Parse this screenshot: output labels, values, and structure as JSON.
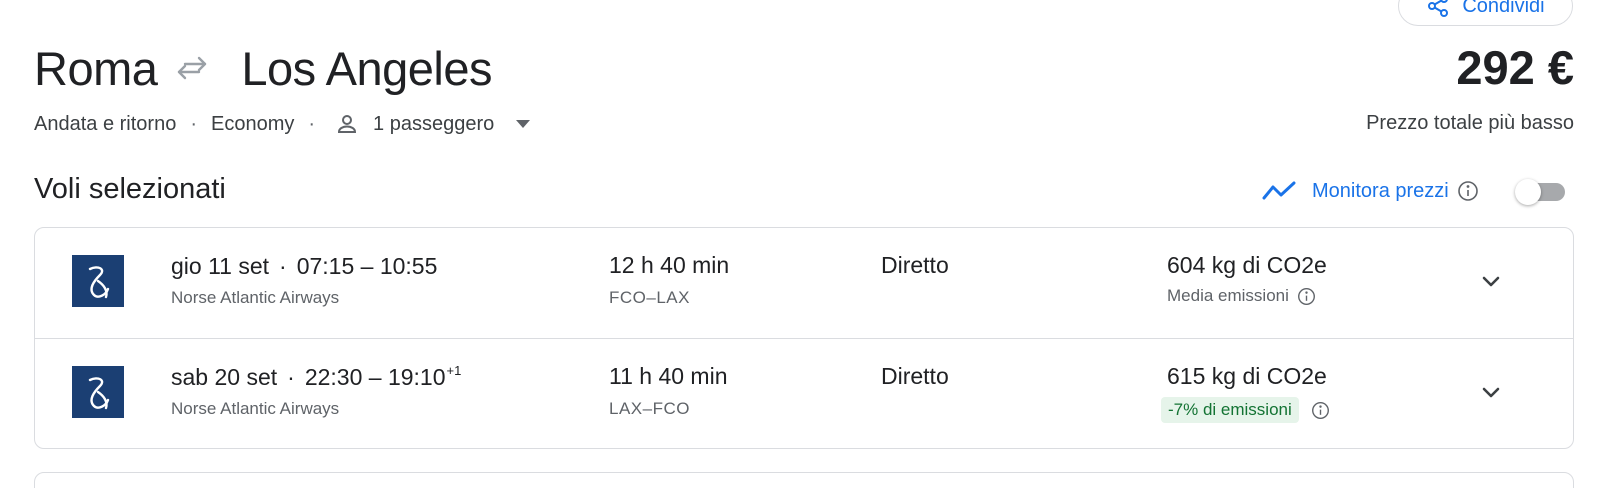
{
  "header": {
    "share_label": "Condividi",
    "origin": "Roma",
    "destination": "Los Angeles",
    "price": "292 €",
    "price_label": "Prezzo totale più basso",
    "trip_type": "Andata e ritorno",
    "cabin_class": "Economy",
    "passengers": "1 passeggero"
  },
  "section": {
    "title": "Voli selezionati",
    "track_label": "Monitora prezzi",
    "track_enabled": false
  },
  "flights": [
    {
      "date": "gio 11 set",
      "time_range": "07:15 – 10:55",
      "day_offset": "",
      "airline": "Norse Atlantic Airways",
      "duration": "12 h 40 min",
      "airports": "FCO–LAX",
      "stops": "Diretto",
      "emissions": "604 kg di CO2e",
      "emissions_note": "Media emissioni"
    },
    {
      "date": "sab 20 set",
      "time_range": "22:30 – 19:10",
      "day_offset": "+1",
      "airline": "Norse Atlantic Airways",
      "duration": "11 h 40 min",
      "airports": "LAX–FCO",
      "stops": "Diretto",
      "emissions": "615 kg di CO2e",
      "emissions_note": "-7% di emissioni"
    }
  ],
  "colors": {
    "accent": "#1a73e8",
    "airline_logo": "#1b3f73",
    "emissions_badge_bg": "#e6f4ea",
    "emissions_badge_text": "#137333"
  },
  "icons": [
    "share-icon",
    "swap-arrows-icon",
    "person-icon",
    "caret-down-icon",
    "trend-line-icon",
    "info-icon",
    "chevron-down-icon",
    "airline-logo"
  ]
}
